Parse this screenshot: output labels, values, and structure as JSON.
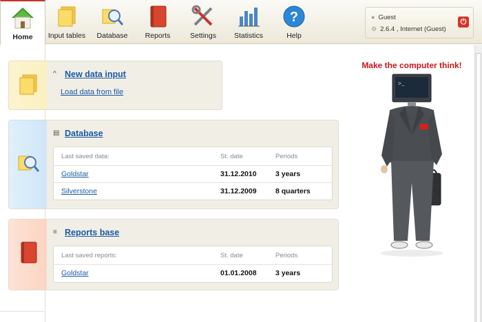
{
  "toolbar": {
    "items": [
      {
        "label": "Home",
        "icon": "home-icon"
      },
      {
        "label": "Input tables",
        "icon": "input-tables-icon"
      },
      {
        "label": "Database",
        "icon": "database-icon"
      },
      {
        "label": "Reports",
        "icon": "reports-icon"
      },
      {
        "label": "Settings",
        "icon": "settings-icon"
      },
      {
        "label": "Statistics",
        "icon": "statistics-icon"
      },
      {
        "label": "Help",
        "icon": "help-icon"
      }
    ],
    "active": "Home"
  },
  "user": {
    "name": "Guest",
    "version": "2.6.4 , Internet (Guest)"
  },
  "new_data": {
    "title": "New data input",
    "load_link": "Load data from file"
  },
  "database": {
    "title": "Database",
    "col_name": "Last saved data:",
    "col_date": "St. date",
    "col_periods": "Periods",
    "rows": [
      {
        "name": "Goldstar",
        "date": "31.12.2010",
        "periods": "3 years"
      },
      {
        "name": "Silverstone",
        "date": "31.12.2009",
        "periods": "8 quarters"
      }
    ]
  },
  "reports": {
    "title": "Reports base",
    "col_name": "Last saved reports:",
    "col_date": "St. date",
    "col_periods": "Periods",
    "rows": [
      {
        "name": "Goldstar",
        "date": "01.01.2008",
        "periods": "3 years"
      }
    ]
  },
  "promo": {
    "title": "Make the computer think!",
    "screen_text": ">_"
  },
  "colors": {
    "accent_red": "#c8161e",
    "link_blue": "#1a5aa8"
  }
}
